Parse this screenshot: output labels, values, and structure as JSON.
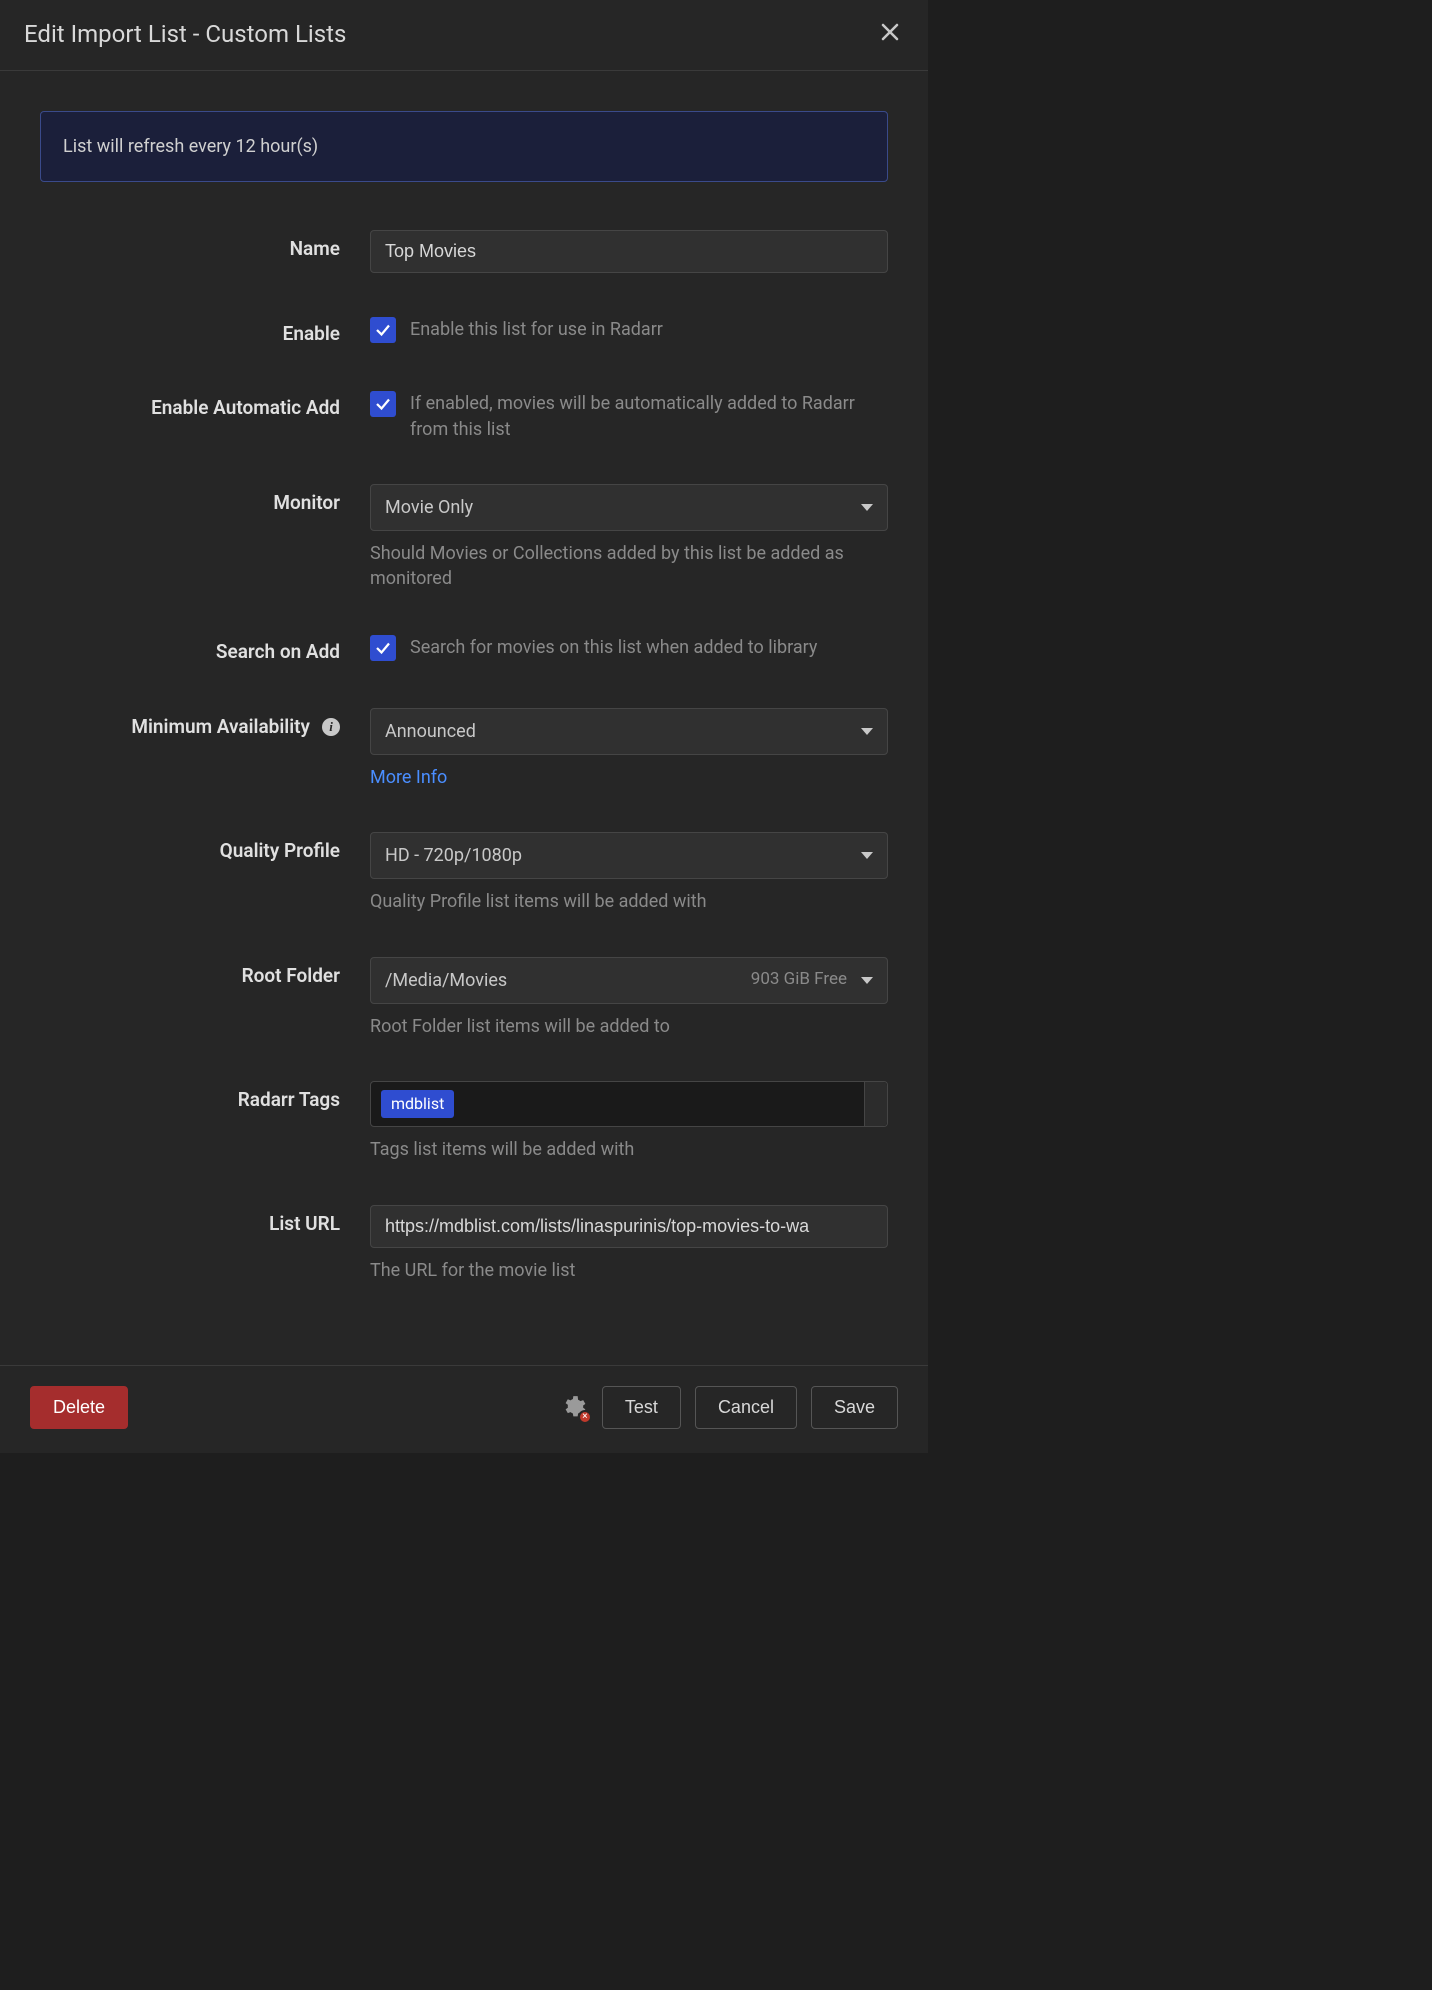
{
  "header": {
    "title": "Edit Import List - Custom Lists"
  },
  "banner": {
    "text": "List will refresh every 12 hour(s)"
  },
  "form": {
    "name": {
      "label": "Name",
      "value": "Top Movies"
    },
    "enable": {
      "label": "Enable",
      "description": "Enable this list for use in Radarr",
      "checked": true
    },
    "enable_auto_add": {
      "label": "Enable Automatic Add",
      "description": "If enabled, movies will be automatically added to Radarr from this list",
      "checked": true
    },
    "monitor": {
      "label": "Monitor",
      "value": "Movie Only",
      "help": "Should Movies or Collections added by this list be added as monitored"
    },
    "search_on_add": {
      "label": "Search on Add",
      "description": "Search for movies on this list when added to library",
      "checked": true
    },
    "min_availability": {
      "label": "Minimum Availability",
      "value": "Announced",
      "link": "More Info"
    },
    "quality_profile": {
      "label": "Quality Profile",
      "value": "HD - 720p/1080p",
      "help": "Quality Profile list items will be added with"
    },
    "root_folder": {
      "label": "Root Folder",
      "value": "/Media/Movies",
      "free": "903 GiB Free",
      "help": "Root Folder list items will be added to"
    },
    "tags": {
      "label": "Radarr Tags",
      "items": [
        "mdblist"
      ],
      "help": "Tags list items will be added with"
    },
    "list_url": {
      "label": "List URL",
      "value": "https://mdblist.com/lists/linaspurinis/top-movies-to-wa",
      "help": "The URL for the movie list"
    }
  },
  "footer": {
    "delete": "Delete",
    "test": "Test",
    "cancel": "Cancel",
    "save": "Save"
  }
}
